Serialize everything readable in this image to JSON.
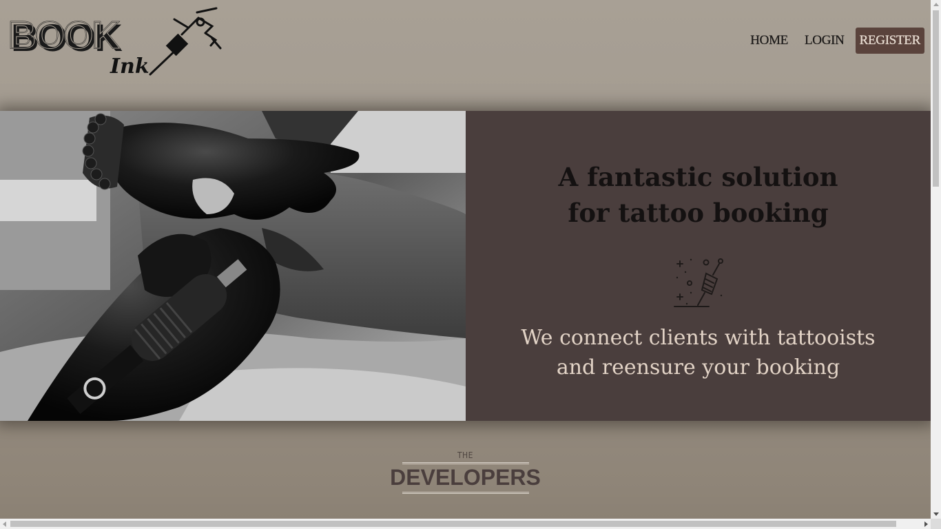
{
  "header": {
    "logo_text": "BOOK Ink",
    "nav": {
      "home": "HOME",
      "login": "LOGIN",
      "register": "REGISTER"
    }
  },
  "hero": {
    "title": "A fantastic solution for tattoo booking",
    "icon": "tattoo-machine-icon",
    "subtitle": "We connect clients with tattooists and reensure your booking",
    "photo": "tattoo-artist-photo"
  },
  "developers": {
    "kicker": "THE",
    "title": "DEVELOPERS"
  },
  "colors": {
    "background": "#a59d92",
    "panel": "#4a3e3d",
    "register_bg": "#5a433c",
    "subtitle_text": "#e2d3c6"
  }
}
